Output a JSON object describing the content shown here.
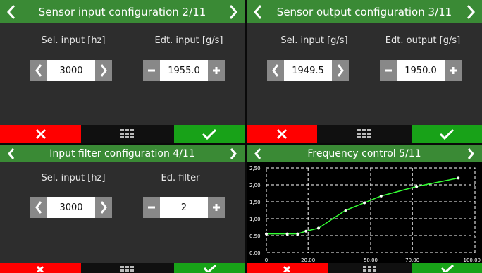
{
  "panels": {
    "p1": {
      "title": "Sensor input configuration 2/11",
      "left_label": "Sel. input [hz]",
      "left_value": "3000",
      "right_label": "Edt. input [g/s]",
      "right_value": "1955.0"
    },
    "p2": {
      "title": "Sensor output configuration 3/11",
      "left_label": "Sel. input [g/s]",
      "left_value": "1949.5",
      "right_label": "Edt. output [g/s]",
      "right_value": "1950.0"
    },
    "p3": {
      "title": "Input filter configuration 4/11",
      "left_label": "Sel. input [hz]",
      "left_value": "3000",
      "right_label": "Ed. filter",
      "right_value": "2"
    },
    "p4": {
      "title": "Frequency control 5/11"
    }
  },
  "icons": {
    "nav_left": "chevron-left-icon",
    "nav_right": "chevron-right-icon",
    "cancel": "close-icon",
    "menu": "grid-menu-icon",
    "confirm": "check-icon",
    "dec": "minus-icon",
    "inc": "plus-icon"
  },
  "colors": {
    "titlebar": "#3a8a35",
    "cancel": "#ff0000",
    "confirm": "#18a218",
    "curve": "#33ff33",
    "panel_bg": "#2d2d2d"
  },
  "chart_data": {
    "type": "line",
    "x": [
      0,
      10,
      15,
      19,
      25,
      38,
      47,
      55,
      72,
      92
    ],
    "series": [
      {
        "values": [
          0.55,
          0.55,
          0.55,
          0.63,
          0.72,
          1.25,
          1.47,
          1.67,
          1.95,
          2.2
        ]
      }
    ],
    "xlim": [
      0,
      100
    ],
    "ylim": [
      0,
      2.5
    ],
    "x_ticks": [
      "0",
      "20,00",
      "50,00",
      "70,00",
      "100,00"
    ],
    "x_tick_values": [
      0,
      20,
      50,
      70,
      100
    ],
    "y_ticks": [
      "0,00",
      "0,50",
      "1,00",
      "1,50",
      "2,00",
      "2,50"
    ],
    "y_tick_values": [
      0,
      0.5,
      1.0,
      1.5,
      2.0,
      2.5
    ],
    "grid": true
  }
}
